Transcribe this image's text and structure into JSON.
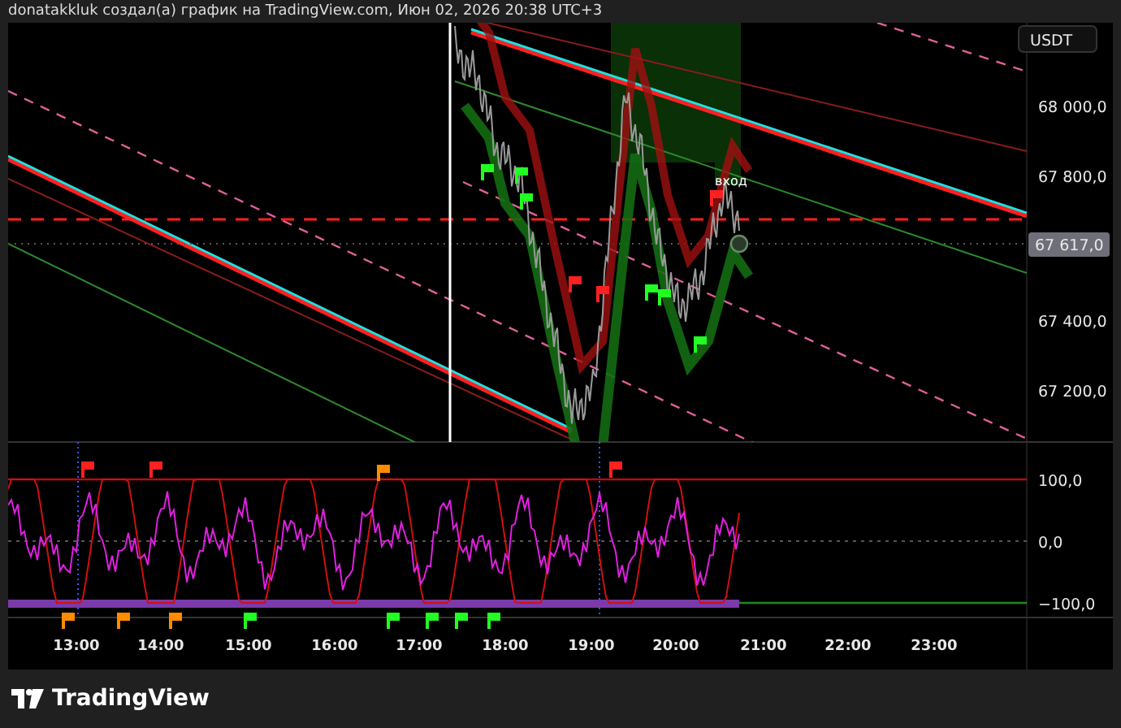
{
  "header": {
    "text": "donatakkluk создал(а) график на TradingView.com, Июн 02, 2026 20:38 UTC+3"
  },
  "currency": "USDT",
  "price_axis": [
    "68 000,0",
    "67 800,0",
    "67 400,0",
    "67 200,0"
  ],
  "current_price": "67 617,0",
  "marker_label": "вход",
  "oscillator_axis": [
    "100,0",
    "0,0",
    "−100,0"
  ],
  "time_axis": [
    "13:00",
    "14:00",
    "15:00",
    "16:00",
    "17:00",
    "18:00",
    "19:00",
    "20:00",
    "21:00",
    "22:00",
    "23:00"
  ],
  "logo": "TradingView"
}
